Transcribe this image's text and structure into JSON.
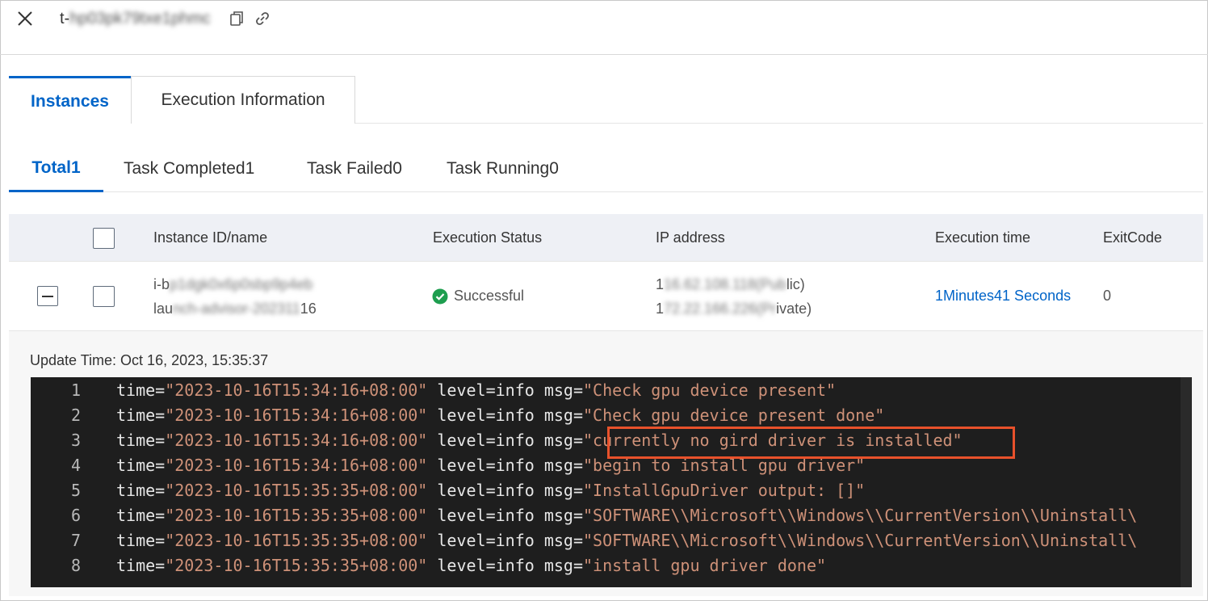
{
  "header": {
    "title_prefix": "t-",
    "title_redacted": "hp03pk79txe1phmc"
  },
  "main_tabs": [
    {
      "label": "Instances"
    },
    {
      "label": "Execution Information"
    }
  ],
  "filter_tabs": [
    {
      "label": "Total1"
    },
    {
      "label": "Task Completed1"
    },
    {
      "label": "Task Failed0"
    },
    {
      "label": "Task Running0"
    }
  ],
  "table": {
    "columns": [
      "Instance ID/name",
      "Execution Status",
      "IP address",
      "Execution time",
      "ExitCode"
    ],
    "row": {
      "id_prefix": "i-b",
      "id_redacted": "p1dgk0x6p0sbp9p4eb",
      "name_prefix": "lau",
      "name_redacted": "nch-advisor-202311",
      "name_suffix": "16",
      "status": "Successful",
      "ip_public_prefix": "1",
      "ip_public_redacted": "16.62.108.118(Pub",
      "ip_public_suffix": "lic)",
      "ip_private_prefix": "1",
      "ip_private_redacted": "72.22.166.226(Pr",
      "ip_private_suffix": "ivate)",
      "execution_time": "1Minutes41 Seconds",
      "exit_code": "0"
    }
  },
  "detail": {
    "update_time": "Update Time: Oct 16, 2023, 15:35:37"
  },
  "log_lines": [
    {
      "n": "1",
      "time": "\"2023-10-16T15:34:16+08:00\"",
      "msg": "\"Check gpu device present\""
    },
    {
      "n": "2",
      "time": "\"2023-10-16T15:34:16+08:00\"",
      "msg": "\"Check gpu device present done\""
    },
    {
      "n": "3",
      "time": "\"2023-10-16T15:34:16+08:00\"",
      "msg": "\"currently no gird driver is installed\""
    },
    {
      "n": "4",
      "time": "\"2023-10-16T15:34:16+08:00\"",
      "msg": "\"begin to install gpu driver\""
    },
    {
      "n": "5",
      "time": "\"2023-10-16T15:35:35+08:00\"",
      "msg": "\"InstallGpuDriver output: []\""
    },
    {
      "n": "6",
      "time": "\"2023-10-16T15:35:35+08:00\"",
      "msg": "\"SOFTWARE\\\\Microsoft\\\\Windows\\\\CurrentVersion\\\\Uninstall\\"
    },
    {
      "n": "7",
      "time": "\"2023-10-16T15:35:35+08:00\"",
      "msg": "\"SOFTWARE\\\\Microsoft\\\\Windows\\\\CurrentVersion\\\\Uninstall\\"
    },
    {
      "n": "8",
      "time": "\"2023-10-16T15:35:35+08:00\"",
      "msg": "\"install gpu driver done\""
    }
  ],
  "log_tokens": {
    "time_key": "time=",
    "level": " level=info ",
    "msg_key": "msg="
  },
  "colors": {
    "accent": "#0064c8",
    "success": "#1e9e4f",
    "highlight_border": "#e8512b",
    "log_string": "#ce9178"
  }
}
